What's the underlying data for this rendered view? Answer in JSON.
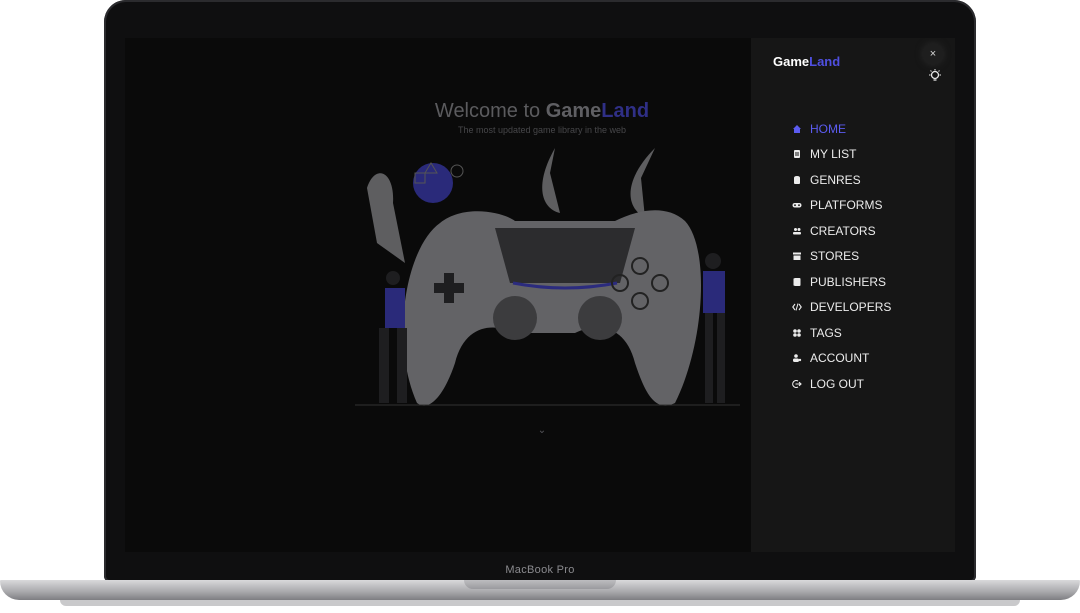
{
  "device": {
    "label": "MacBook Pro"
  },
  "hero": {
    "title_prefix": "Welcome to ",
    "brand_part1": "Game",
    "brand_part2": "Land",
    "subtitle": "The most updated game library in the web"
  },
  "drawer": {
    "logo_part1": "Game",
    "logo_part2": "Land",
    "close_label": "×",
    "menu": [
      {
        "label": "HOME",
        "icon": "home-icon",
        "active": true
      },
      {
        "label": "MY LIST",
        "icon": "list-icon"
      },
      {
        "label": "GENRES",
        "icon": "genres-icon"
      },
      {
        "label": "PLATFORMS",
        "icon": "gamepad-icon"
      },
      {
        "label": "CREATORS",
        "icon": "users-icon"
      },
      {
        "label": "STORES",
        "icon": "store-icon"
      },
      {
        "label": "PUBLISHERS",
        "icon": "book-icon"
      },
      {
        "label": "DEVELOPERS",
        "icon": "code-icon"
      },
      {
        "label": "TAGS",
        "icon": "tags-icon"
      },
      {
        "label": "ACCOUNT",
        "icon": "account-icon"
      },
      {
        "label": "LOG OUT",
        "icon": "logout-icon"
      }
    ]
  },
  "colors": {
    "accent": "#5b5bf0",
    "drawer_bg": "#161616",
    "screen_bg": "#0a0a0a"
  }
}
